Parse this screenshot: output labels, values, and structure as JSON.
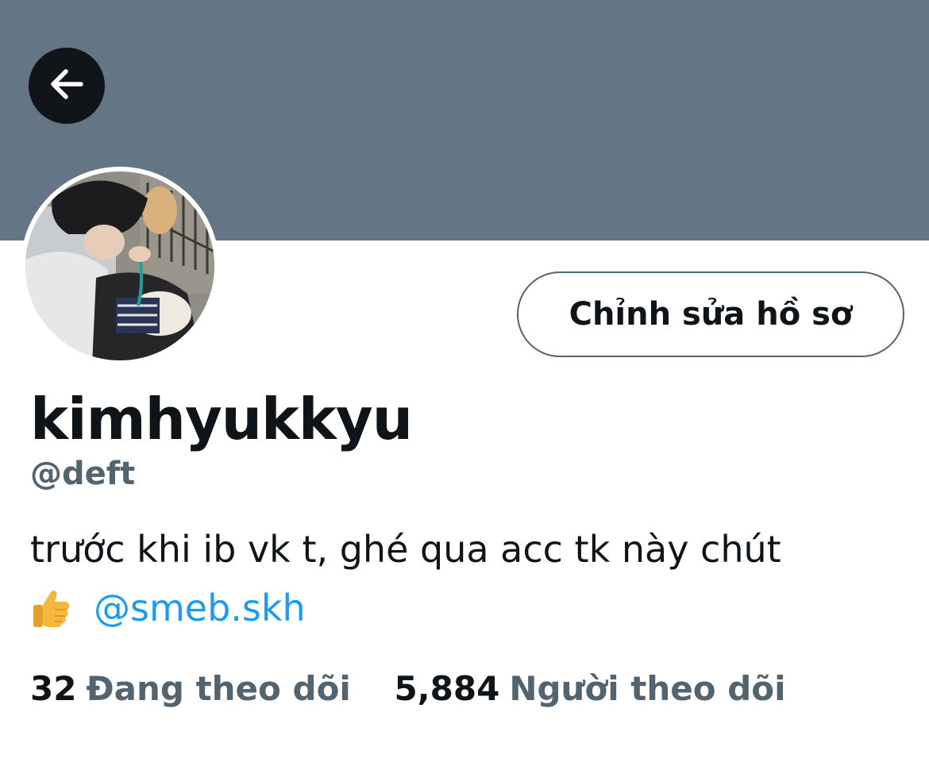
{
  "profile": {
    "display_name": "kimhyukkyu",
    "handle": "@deft",
    "bio_text": "trước khi ib vk t, ghé qua acc tk này chút",
    "bio_emoji": "👍",
    "bio_mention": "@smeb.skh",
    "edit_button_label": "Chỉnh sửa hồ sơ",
    "following_count": "32",
    "following_label": "Đang theo dõi",
    "followers_count": "5,884",
    "followers_label": "Người theo dõi"
  },
  "icons": {
    "back": "back-arrow-icon",
    "thumbs_up": "thumbs-up-icon",
    "avatar": "avatar-photo"
  },
  "colors": {
    "banner": "#647586",
    "back_button_bg": "#111519",
    "text_primary": "#0f1419",
    "text_secondary": "#536471",
    "link": "#1d9bf0",
    "button_border": "#536471"
  }
}
